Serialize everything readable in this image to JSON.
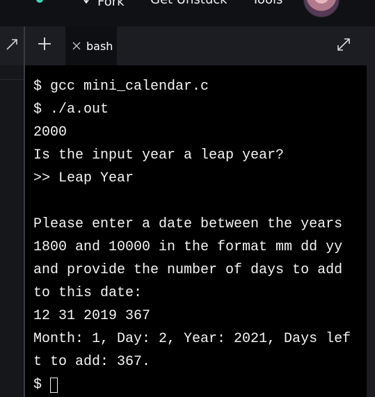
{
  "topbar": {
    "fork_label": "Fork",
    "unstuck_label": "Get Unstuck",
    "tools_label": "Tools"
  },
  "tabbar": {
    "tab_label": "bash"
  },
  "terminal": {
    "lines": [
      "$ gcc mini_calendar.c",
      "$ ./a.out",
      "2000",
      "Is the input year a leap year?",
      ">> Leap Year",
      "",
      "Please enter a date between the years",
      "1800 and 10000 in the format mm dd yy",
      "and provide the number of days to add",
      "to this date:",
      "12 31 2019 367",
      "Month: 1, Day: 2, Year: 2021, Days lef",
      "t to add: 367."
    ],
    "prompt": "$"
  },
  "colors": {
    "terminal_bg": "#000000",
    "terminal_text": "#f4f4f4",
    "tabbar_bg": "#1c1d22",
    "active_tab_bg": "#0e0f12",
    "topbar_bg": "#101115",
    "accent": "#37d7b3"
  },
  "icons": [
    "fork-icon",
    "plus-icon",
    "close-icon",
    "expand-icon",
    "avatar"
  ]
}
